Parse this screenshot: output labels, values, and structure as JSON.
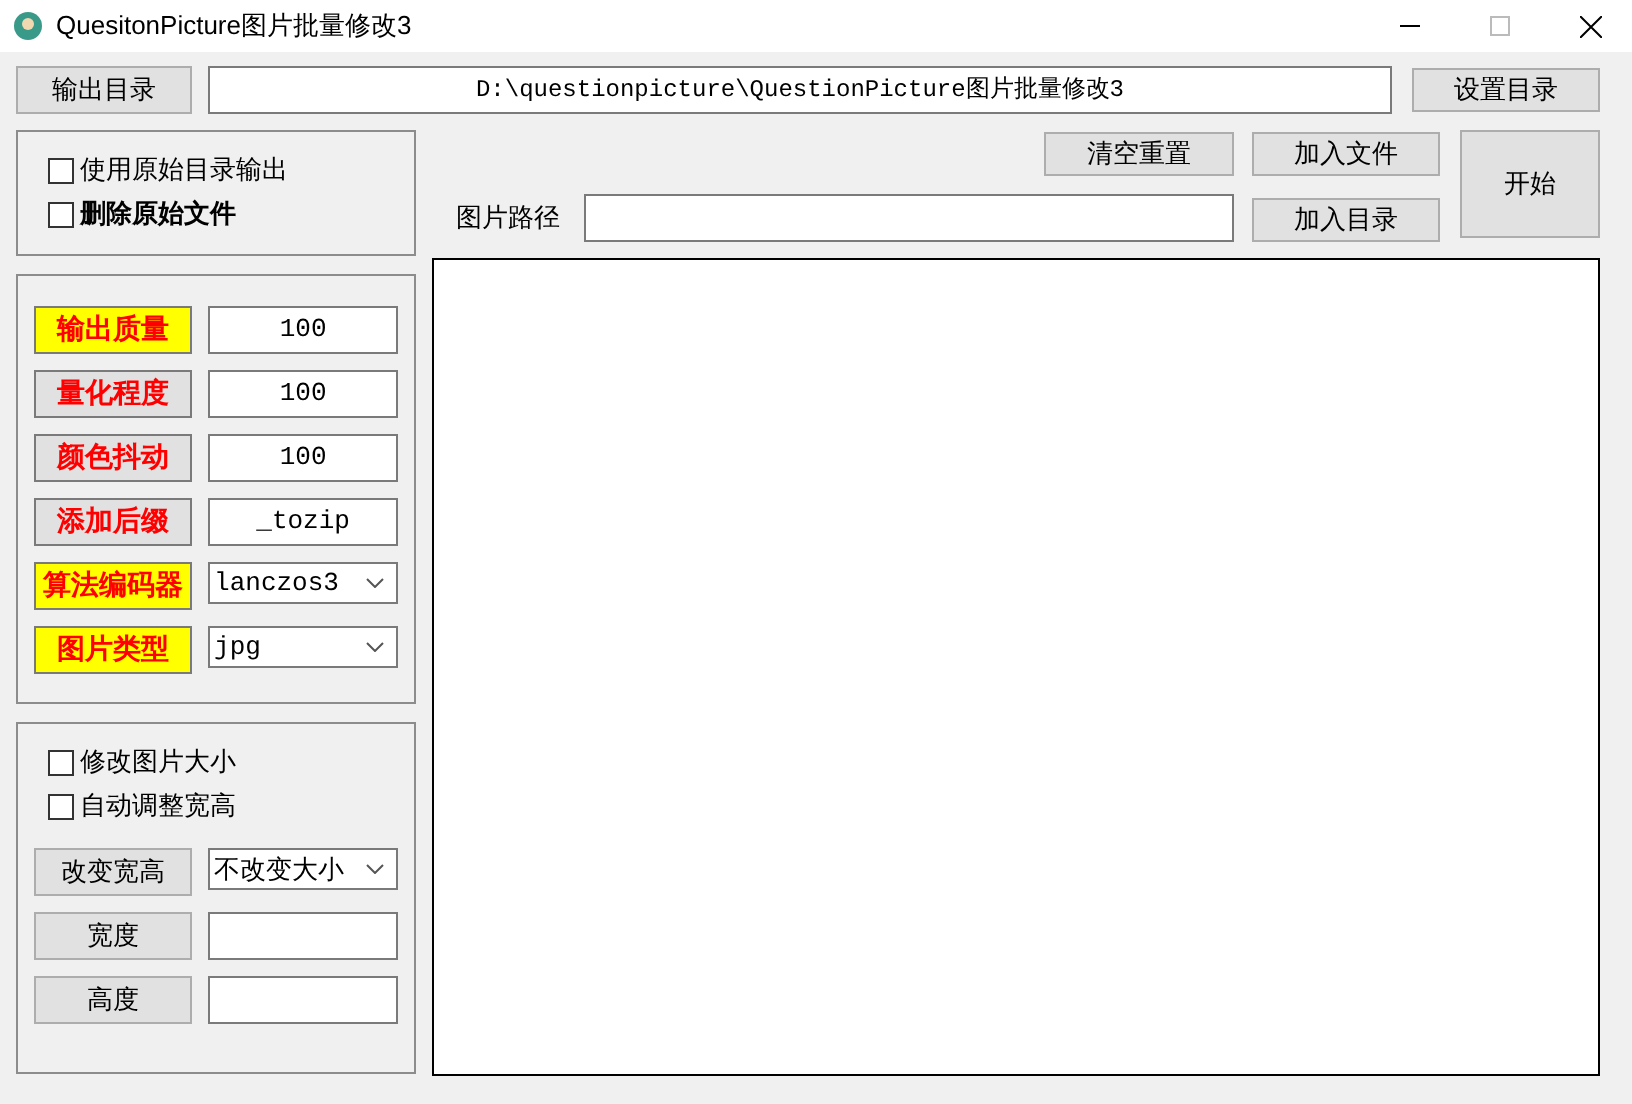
{
  "window": {
    "title": "QuesitonPicture图片批量修改3"
  },
  "output": {
    "button": "输出目录",
    "path": "D:\\questionpicture\\QuestionPicture图片批量修改3",
    "set_button": "设置目录"
  },
  "options": [
    {
      "label": "使用原始目录输出",
      "checked": false,
      "bold": false
    },
    {
      "label": "删除原始文件",
      "checked": false,
      "bold": true
    }
  ],
  "actions": {
    "clear": "清空重置",
    "add_file": "加入文件",
    "add_dir": "加入目录",
    "start": "开始",
    "path_label": "图片路径"
  },
  "params": [
    {
      "label": "输出质量",
      "highlighted": true,
      "kind": "text",
      "value": "100"
    },
    {
      "label": "量化程度",
      "highlighted": false,
      "kind": "text",
      "value": "100"
    },
    {
      "label": "颜色抖动",
      "highlighted": false,
      "kind": "text",
      "value": "100"
    },
    {
      "label": "添加后缀",
      "highlighted": false,
      "kind": "text",
      "value": "_tozip"
    },
    {
      "label": "算法编码器",
      "highlighted": true,
      "kind": "select",
      "value": "lanczos3"
    },
    {
      "label": "图片类型",
      "highlighted": true,
      "kind": "select",
      "value": "jpg"
    }
  ],
  "resize_options": [
    {
      "label": "修改图片大小",
      "checked": false
    },
    {
      "label": "自动调整宽高",
      "checked": false
    }
  ],
  "resize_fields": [
    {
      "label": "改变宽高",
      "kind": "select",
      "value": "不改变大小"
    },
    {
      "label": "宽度",
      "kind": "text"
    },
    {
      "label": "高度",
      "kind": "text"
    }
  ]
}
